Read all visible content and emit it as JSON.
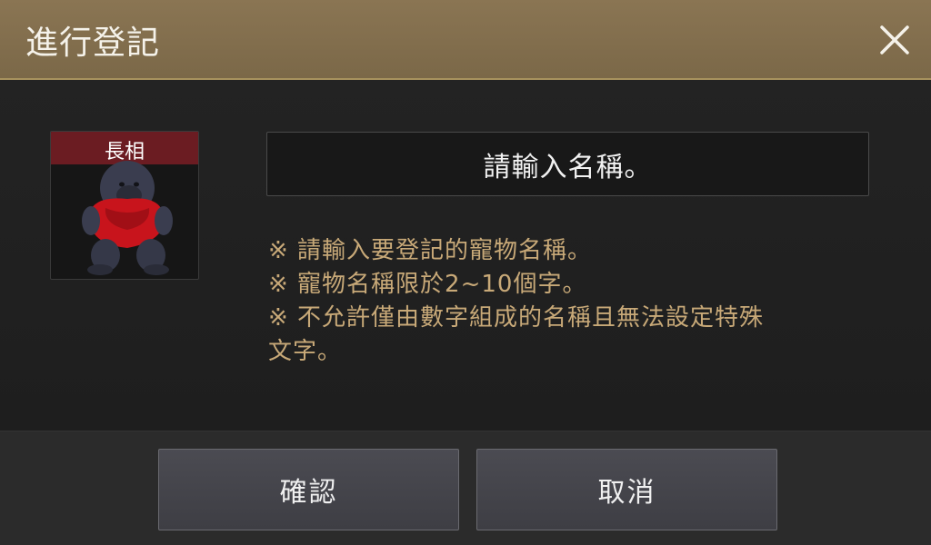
{
  "dialog": {
    "title": "進行登記",
    "close_icon": "close-icon"
  },
  "pet": {
    "label": "長相",
    "image_icon": "pet-gorilla-icon",
    "label_bar_color": "#6b1c22"
  },
  "name_input": {
    "placeholder": "請輸入名稱。"
  },
  "notes": [
    "※ 請輸入要登記的寵物名稱。",
    "※ 寵物名稱限於2~10個字。",
    "※ 不允許僅由數字組成的名稱且無法設定特殊",
    "文字。"
  ],
  "buttons": {
    "confirm": "確認",
    "cancel": "取消"
  },
  "colors": {
    "title_bar": "#7f6b4b",
    "note_text": "#c8a978",
    "background": "#222222"
  }
}
